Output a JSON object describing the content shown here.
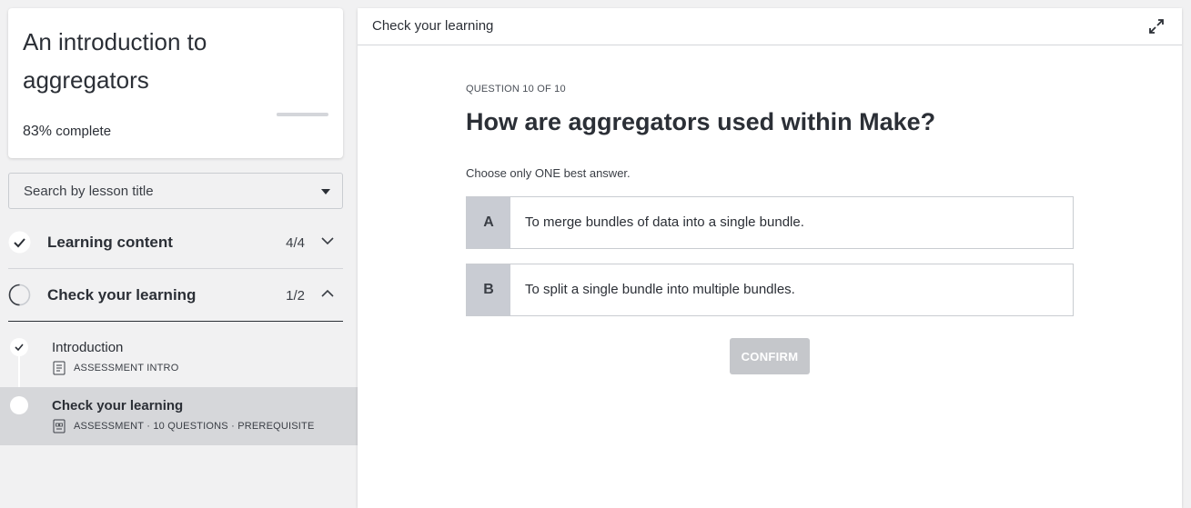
{
  "course": {
    "title": "An introduction to aggregators",
    "progress_pct": "83%",
    "progress_suffix": "complete",
    "progress_value": 0.83
  },
  "search": {
    "placeholder": "Search by lesson title"
  },
  "sections": [
    {
      "title": "Learning content",
      "count": "4/4",
      "status": "complete",
      "expanded": false
    },
    {
      "title": "Check your learning",
      "count": "1/2",
      "status": "in-progress",
      "expanded": true
    }
  ],
  "lessons": [
    {
      "name": "Introduction",
      "meta": "ASSESSMENT INTRO",
      "completed": true,
      "icon": "document-icon"
    },
    {
      "name": "Check your learning",
      "meta": "ASSESSMENT · 10 QUESTIONS · PREREQUISITE",
      "completed": false,
      "active": true,
      "icon": "quiz-icon"
    }
  ],
  "main": {
    "header_title": "Check your learning",
    "question_label": "QUESTION 10 OF 10",
    "question_title": "How are aggregators used within Make?",
    "instruction": "Choose only ONE best answer.",
    "options": [
      {
        "letter": "A",
        "text": "To merge bundles of data into a single bundle."
      },
      {
        "letter": "B",
        "text": "To split a single bundle into multiple bundles."
      }
    ],
    "confirm_label": "CONFIRM"
  },
  "colors": {
    "text": "#2b2f36",
    "option_letter_bg": "#c9ccd3",
    "confirm_disabled": "#c5c7cb",
    "active_lesson_bg": "#d6d7da"
  }
}
